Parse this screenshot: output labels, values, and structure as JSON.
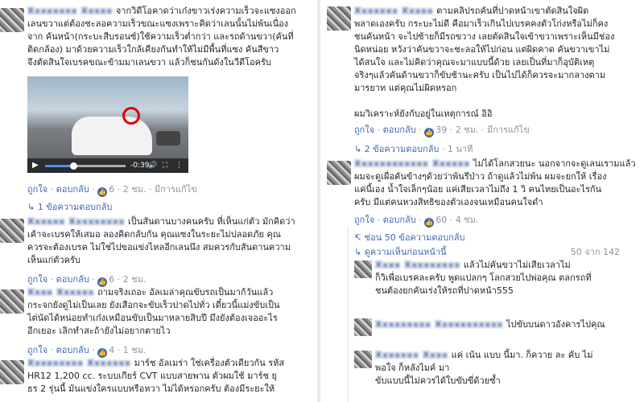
{
  "comments_left": [
    {
      "lines": [
        "จากวิดีโอคาดว่าเก๋งขาวเร่งความเร็วจะแซงออก",
        "เลนขวาแต่ต้องชะลอความเร็วขณะแซงเพราะคิดว่าเลนนั้นไม่พ้นเนื่อง",
        "จาก คันหน้า(กระบะสีบรอนซ์)ใช้ความเร็วต่ำกว่า และรถด้านขวา(คันที่",
        "ติดกล้อง) มาด้วยความเร็วใกล้เคียงกันทำให้ไม่มีพื้นที่แซง คันสีขาว",
        "จึงตัดสินใจเบรคขณะข้ามมาเลนขวา แล้วก็ชนกันดังในวีดีโอครับ"
      ],
      "video": {
        "time": "-0:39",
        "progress": 0.35
      },
      "actions": {
        "like": "ถูกใจ",
        "reply": "ตอบกลับ",
        "likes": "6",
        "time": "2 ชม.",
        "edited": "มีการแก้ไข"
      },
      "reply_toggle": {
        "text": "1 ข้อความตอบกลับ"
      }
    },
    {
      "lines": [
        "เป็นสันดานบางคนครับ ที่เห็นแก่ตัว มักคิดว่า",
        "เค้าจะเบรคให้เสมอ ลองคิดกลับกัน คุณแซงในระยะไม่ปลอดภัย คุณ",
        "ควรจะต้องเบรค ไม่ใช่ไปขอแข่งไหลอีกเลนนึง สมควรกับสันดานความ",
        "เห็นแก่ตัวครับ"
      ],
      "actions": {
        "like": "ถูกใจ",
        "reply": "ตอบกลับ",
        "likes": "6",
        "time": "2 ชม."
      }
    },
    {
      "lines": [
        "ถามจริงเถอะ อัลเมล่าคุณขับรถเป็นมาก้วันแล้ว",
        "กระจกยังดูไม่เป็นเลย ยังเสือกจะขับเร็วปาดไปทั่ว เดี๋ยวนี้แม่งขับเป็น",
        "ไต่นัดได้หน่อยทำเก๋งเหมือนขับเป็นมาหลายสิบปี มึงยังต้องเจออะไร",
        "อีกเยอะ เลิกทำสะถ้ายังไม่อยากตายไว"
      ],
      "actions": {
        "like": "ถูกใจ",
        "reply": "ตอบกลับ",
        "likes": "4",
        "time": "1 ชม."
      }
    },
    {
      "lines": [
        "มาร์ช อัลเมร่า ใช่เครื่องตัวเดียวกัน รหัส",
        "HR12 1,200 cc. ระบบเกียร์ CVT แบบสายพาน ตัวผมใช้ มาร์ช ยุ",
        "ธร 2 รุ่นนี้ มันแข่งใครแบบหรือหวา ไม่ได้หรอกครับ ต้องมีระยะให้"
      ]
    }
  ],
  "comments_right": [
    {
      "lines": [
        "ตามคลิปรถคันที่ปาดหน้าเขาตัดสินใจผิด",
        "พลาดเองครับ กระบะไม่ดี คือมาเร็วเกินไปเบรคคงตัวโก่งหรือไม่ก็คง",
        "ชนคันหน้า จะไปซ้ายก็มีรถขวาง เลยตัดสินใจเข้าขวาเพราะเห็นมีช่อง",
        "นิดหน่อย หวังว่าคันขวาจะชะลอให้ไปก่อน แต่ผิดคาด คันขวาเขาไม่",
        "ได้สนใจ และไม่คิดว่าคุณจะมาแบบนี้ด้วย เลยเป็นที่มาก็อุบัติเหตุ",
        "จริงๆแล้วคันด้านขวาก็ขับช้านะครับ เป็นไปได้ก็ควรจะมากลางตาม",
        "มารยาท แต่คุณไม่ผิดหรอก",
        "",
        "ผมวิเคราะห์ยังกับอยู่ในเหตุการณ์ อิอิ"
      ],
      "actions": {
        "like": "ถูกใจ",
        "reply": "ตอบกลับ",
        "likes": "39",
        "time": "2 ชม.",
        "edited": "มีการแก้ไข"
      },
      "reply_toggle": {
        "text": "2 ข้อความตอบกลับ",
        "time": "1 นาที"
      }
    },
    {
      "lines": [
        "ไม่ได้โลกสวยนะ นอกจากจะดูเลนเรามแล้ว",
        "ผมจะดูเผื่อคันข้างๆด้วยว่าพ้นรึป่าว ถ้าดูแล้วไม่พ้น ผมจะยกให้ เรื่อง",
        "แค่นี้เอง น้ำใจเล็กๆน้อย แค่เสียเวลาไม่ถึง 1 วิ คนไทยเป็นอะไรกัน",
        "ครับ มีแต่คนหวงสิทธิของตัวเองจนเหมือนคนใจดำ"
      ],
      "actions": {
        "like": "ถูกใจ",
        "reply": "ตอบกลับ",
        "likes": "60",
        "time": "4 ชม."
      }
    }
  ],
  "hide_replies": "ซ่อน 50 ข้อความตอบกลับ",
  "view_previous": {
    "text": "ดูความเห็นก่อนหน้านี้",
    "count": "50 จาก 142"
  },
  "replies": [
    {
      "lines": [
        "แล้วไม่คันขวาไม่เสียเวลาไม่",
        "ก็วิเพื่อเบรคละครับ พูดแปลกๆ โลกสวยไปพ่อคุณ ตลกรถที่",
        "ชนต้องยกคันเร่งให้รถที่ปาดหน้า555"
      ]
    },
    {
      "lines": [
        "ไปขับบนดาวอังคารไปคุณ"
      ]
    },
    {
      "lines": [
        "แค่ เน้น แบบ นี้มา. ก็ควาย ละ คับ ไม่",
        "พอใจ ก็หลังไมค์ มา",
        "ขับแบบนี้ไม่ควรได้ใบขับขี่ด้วยซ้ำ"
      ]
    }
  ]
}
